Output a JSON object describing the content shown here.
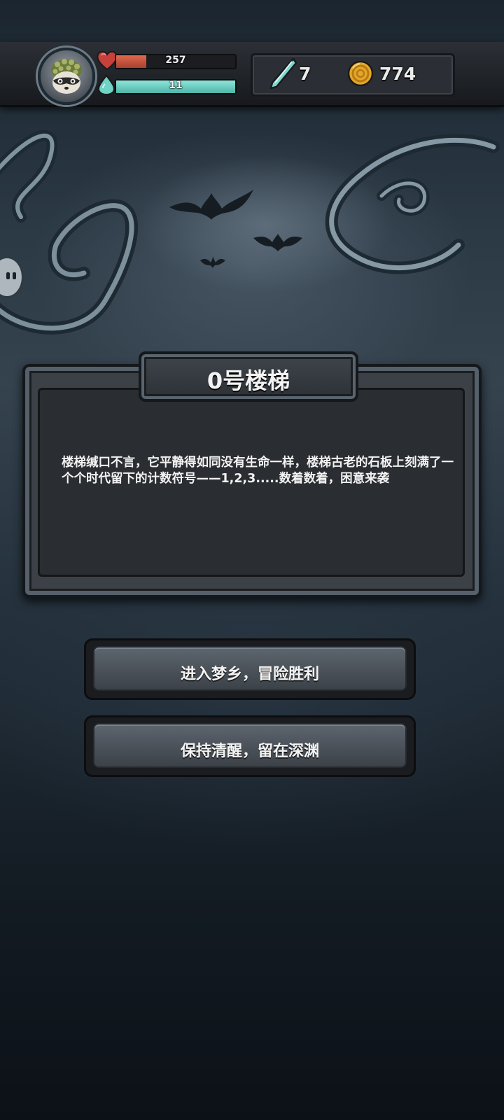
{
  "hud": {
    "hp_value": "257",
    "hp_fraction": 0.25,
    "mana_value": "11",
    "mana_fraction": 1.0,
    "crystals": "7",
    "coins": "774",
    "colors": {
      "hp": "#c8503a",
      "mana": "#6fd3c6",
      "crystal": "#7fd6d1",
      "coin": "#e3a82a"
    },
    "icons": {
      "hp": "heart-icon",
      "mana": "mana-drop-icon",
      "crystals": "crystal-icon",
      "coins": "coin-icon",
      "avatar": "raccoon-avatar"
    }
  },
  "event": {
    "title": "0号楼梯",
    "description": "楼梯缄口不言，它平静得如同没有生命一样，楼梯古老的石板上刻满了一个个时代留下的计数符号——1,2,3.....数着数着，困意来袭"
  },
  "choices": [
    {
      "label": "进入梦乡，冒险胜利"
    },
    {
      "label": "保持清醒，留在深渊"
    }
  ]
}
